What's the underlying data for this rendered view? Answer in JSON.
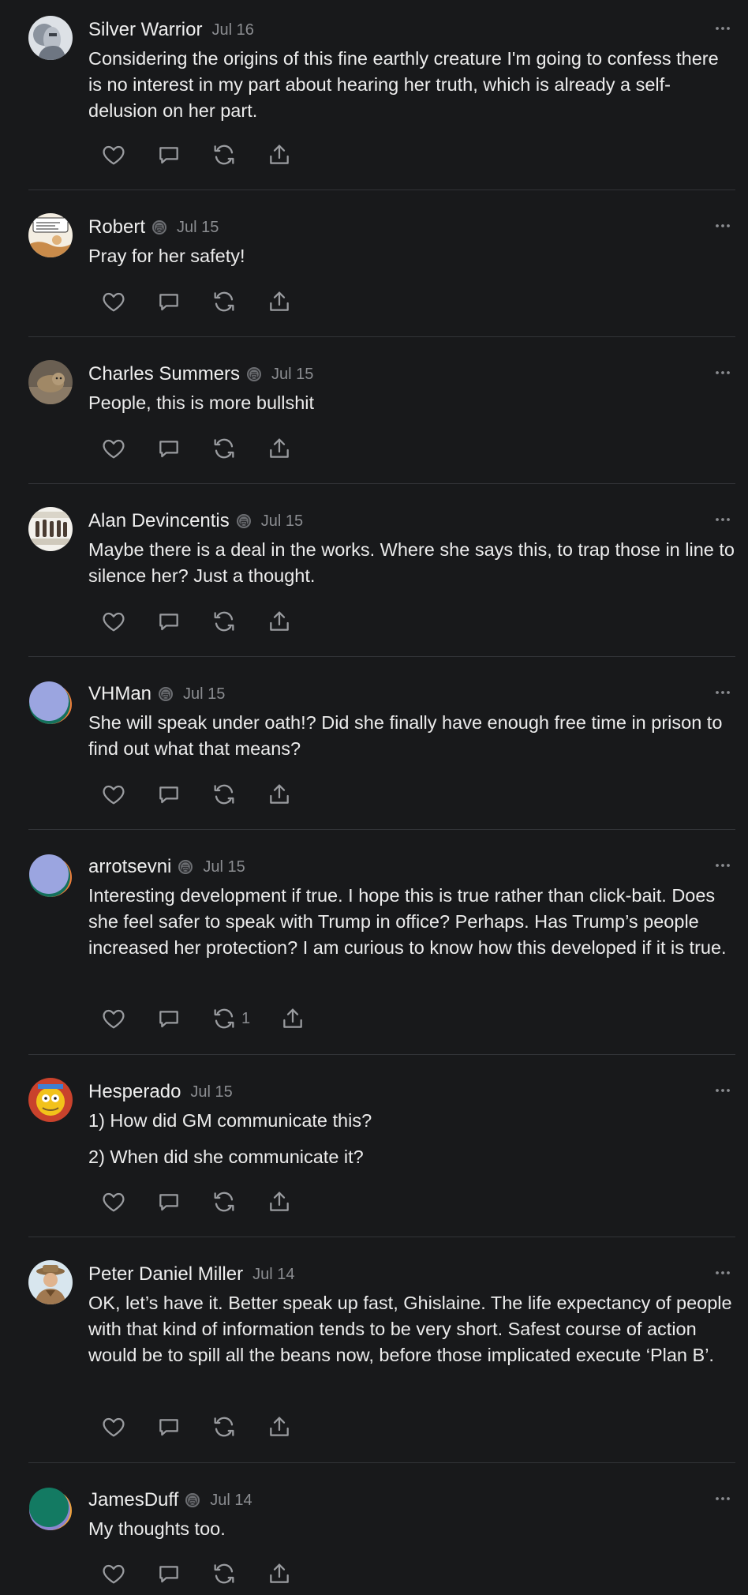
{
  "comments": [
    {
      "author": "Silver Warrior",
      "date": "Jul 16",
      "badge": false,
      "avatar": "photo-knight",
      "paragraphs": [
        "Considering the origins of this fine earthly creature I'm going to confess there is no interest in my part about hearing her truth, which is already a self-delusion on her part."
      ],
      "restack_count": ""
    },
    {
      "author": "Robert",
      "date": "Jul 15",
      "badge": true,
      "avatar": "photo-comic",
      "paragraphs": [
        "Pray for her safety!"
      ],
      "restack_count": ""
    },
    {
      "author": "Charles Summers",
      "date": "Jul 15",
      "badge": true,
      "avatar": "photo-cat",
      "paragraphs": [
        "People, this is more bullshit"
      ],
      "restack_count": ""
    },
    {
      "author": "Alan Devincentis",
      "date": "Jul 15",
      "badge": true,
      "avatar": "photo-group",
      "paragraphs": [
        "Maybe there is a deal in the works. Where she says this, to trap those in line to silence her? Just a thought."
      ],
      "restack_count": ""
    },
    {
      "author": "VHMan",
      "date": "Jul 15",
      "badge": true,
      "avatar": "default-lavender",
      "paragraphs": [
        "She will speak under oath!? Did she finally have enough free time in prison to find out what that means?"
      ],
      "restack_count": ""
    },
    {
      "author": "arrotsevni",
      "date": "Jul 15",
      "badge": true,
      "avatar": "default-lavender",
      "paragraphs": [
        "Interesting development if true. I hope this is true rather than click-bait. Does she feel safer to speak with Trump in office? Perhaps. Has Trump’s people increased her protection? I am curious to know how this developed if it is true."
      ],
      "restack_count": "1"
    },
    {
      "author": "Hesperado",
      "date": "Jul 15",
      "badge": false,
      "avatar": "photo-cartoon",
      "paragraphs": [
        "1) How did GM communicate this?",
        "2) When did she communicate it?"
      ],
      "restack_count": ""
    },
    {
      "author": "Peter Daniel Miller",
      "date": "Jul 14",
      "badge": false,
      "avatar": "photo-man",
      "paragraphs": [
        "OK, let’s have it. Better speak up fast, Ghislaine. The life expectancy of people with that kind of information tends to be very short. Safest course of action would be to spill all the beans now, before those implicated execute ‘Plan B’."
      ],
      "restack_count": ""
    },
    {
      "author": "JamesDuff",
      "date": "Jul 14",
      "badge": true,
      "avatar": "default-teal",
      "paragraphs": [
        "My thoughts too."
      ],
      "restack_count": ""
    }
  ],
  "icons": {
    "like": "heart-icon",
    "reply": "comment-bubble-icon",
    "restack": "restack-icon",
    "share": "share-icon",
    "more": "more-dots-icon",
    "badge": "subscriber-badge-icon"
  },
  "colors": {
    "background": "#18191b",
    "text": "#ececec",
    "muted": "#8b8d91",
    "divider": "#323438"
  }
}
